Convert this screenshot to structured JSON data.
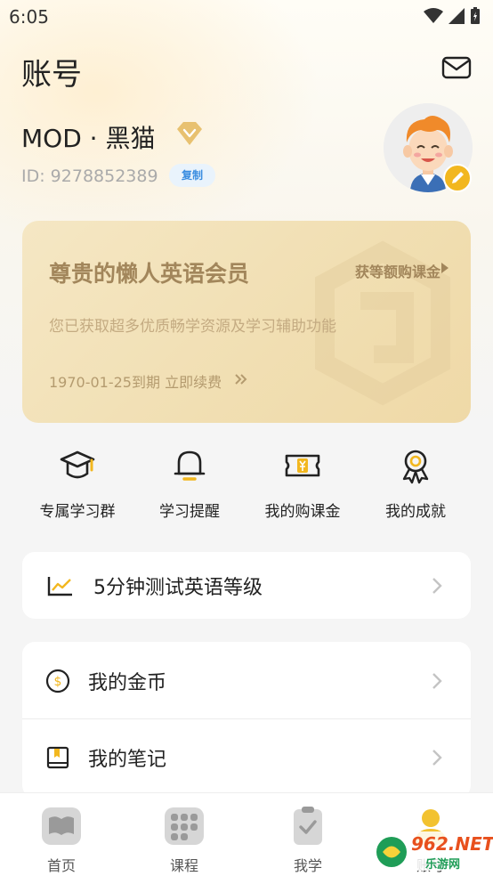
{
  "status_bar": {
    "time": "6:05"
  },
  "header": {
    "title": "账号",
    "mail_icon": "mail-icon"
  },
  "profile": {
    "name": "MOD · 黑猫",
    "id_text": "ID: 9278852389",
    "copy_label": "复制",
    "vip_color": "#e8c170"
  },
  "member_card": {
    "title": "尊贵的懒人英语会员",
    "link": "获等额购课金",
    "description": "您已获取超多优质畅学资源及学习辅助功能",
    "expiry": "1970-01-25到期 立即续费"
  },
  "quick_actions": [
    {
      "label": "专属学习群",
      "icon": "graduation-cap-icon"
    },
    {
      "label": "学习提醒",
      "icon": "bell-icon"
    },
    {
      "label": "我的购课金",
      "icon": "coupon-icon"
    },
    {
      "label": "我的成就",
      "icon": "medal-icon"
    }
  ],
  "level_test": {
    "label": "5分钟测试英语等级"
  },
  "menu": [
    {
      "label": "我的金币",
      "icon": "coin-icon"
    },
    {
      "label": "我的笔记",
      "icon": "notebook-icon"
    }
  ],
  "bottom_nav": [
    {
      "label": "首页",
      "icon": "book-icon"
    },
    {
      "label": "课程",
      "icon": "grid-icon"
    },
    {
      "label": "我学",
      "icon": "clipboard-icon"
    },
    {
      "label": "账号",
      "icon": "user-icon"
    }
  ],
  "watermark": {
    "text": "962.NET",
    "subtext": "乐游网"
  },
  "colors": {
    "accent": "#f2b71f",
    "card_text": "#a2865b",
    "card_bg": "#f3e2bb"
  }
}
